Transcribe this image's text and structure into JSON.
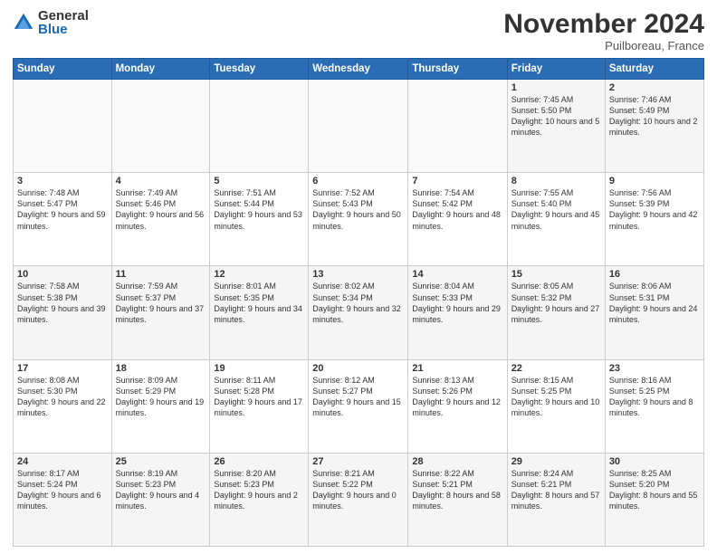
{
  "logo": {
    "general": "General",
    "blue": "Blue"
  },
  "header": {
    "month": "November 2024",
    "location": "Puilboreau, France"
  },
  "days_of_week": [
    "Sunday",
    "Monday",
    "Tuesday",
    "Wednesday",
    "Thursday",
    "Friday",
    "Saturday"
  ],
  "weeks": [
    [
      {
        "day": "",
        "info": ""
      },
      {
        "day": "",
        "info": ""
      },
      {
        "day": "",
        "info": ""
      },
      {
        "day": "",
        "info": ""
      },
      {
        "day": "",
        "info": ""
      },
      {
        "day": "1",
        "info": "Sunrise: 7:45 AM\nSunset: 5:50 PM\nDaylight: 10 hours and 5 minutes."
      },
      {
        "day": "2",
        "info": "Sunrise: 7:46 AM\nSunset: 5:49 PM\nDaylight: 10 hours and 2 minutes."
      }
    ],
    [
      {
        "day": "3",
        "info": "Sunrise: 7:48 AM\nSunset: 5:47 PM\nDaylight: 9 hours and 59 minutes."
      },
      {
        "day": "4",
        "info": "Sunrise: 7:49 AM\nSunset: 5:46 PM\nDaylight: 9 hours and 56 minutes."
      },
      {
        "day": "5",
        "info": "Sunrise: 7:51 AM\nSunset: 5:44 PM\nDaylight: 9 hours and 53 minutes."
      },
      {
        "day": "6",
        "info": "Sunrise: 7:52 AM\nSunset: 5:43 PM\nDaylight: 9 hours and 50 minutes."
      },
      {
        "day": "7",
        "info": "Sunrise: 7:54 AM\nSunset: 5:42 PM\nDaylight: 9 hours and 48 minutes."
      },
      {
        "day": "8",
        "info": "Sunrise: 7:55 AM\nSunset: 5:40 PM\nDaylight: 9 hours and 45 minutes."
      },
      {
        "day": "9",
        "info": "Sunrise: 7:56 AM\nSunset: 5:39 PM\nDaylight: 9 hours and 42 minutes."
      }
    ],
    [
      {
        "day": "10",
        "info": "Sunrise: 7:58 AM\nSunset: 5:38 PM\nDaylight: 9 hours and 39 minutes."
      },
      {
        "day": "11",
        "info": "Sunrise: 7:59 AM\nSunset: 5:37 PM\nDaylight: 9 hours and 37 minutes."
      },
      {
        "day": "12",
        "info": "Sunrise: 8:01 AM\nSunset: 5:35 PM\nDaylight: 9 hours and 34 minutes."
      },
      {
        "day": "13",
        "info": "Sunrise: 8:02 AM\nSunset: 5:34 PM\nDaylight: 9 hours and 32 minutes."
      },
      {
        "day": "14",
        "info": "Sunrise: 8:04 AM\nSunset: 5:33 PM\nDaylight: 9 hours and 29 minutes."
      },
      {
        "day": "15",
        "info": "Sunrise: 8:05 AM\nSunset: 5:32 PM\nDaylight: 9 hours and 27 minutes."
      },
      {
        "day": "16",
        "info": "Sunrise: 8:06 AM\nSunset: 5:31 PM\nDaylight: 9 hours and 24 minutes."
      }
    ],
    [
      {
        "day": "17",
        "info": "Sunrise: 8:08 AM\nSunset: 5:30 PM\nDaylight: 9 hours and 22 minutes."
      },
      {
        "day": "18",
        "info": "Sunrise: 8:09 AM\nSunset: 5:29 PM\nDaylight: 9 hours and 19 minutes."
      },
      {
        "day": "19",
        "info": "Sunrise: 8:11 AM\nSunset: 5:28 PM\nDaylight: 9 hours and 17 minutes."
      },
      {
        "day": "20",
        "info": "Sunrise: 8:12 AM\nSunset: 5:27 PM\nDaylight: 9 hours and 15 minutes."
      },
      {
        "day": "21",
        "info": "Sunrise: 8:13 AM\nSunset: 5:26 PM\nDaylight: 9 hours and 12 minutes."
      },
      {
        "day": "22",
        "info": "Sunrise: 8:15 AM\nSunset: 5:25 PM\nDaylight: 9 hours and 10 minutes."
      },
      {
        "day": "23",
        "info": "Sunrise: 8:16 AM\nSunset: 5:25 PM\nDaylight: 9 hours and 8 minutes."
      }
    ],
    [
      {
        "day": "24",
        "info": "Sunrise: 8:17 AM\nSunset: 5:24 PM\nDaylight: 9 hours and 6 minutes."
      },
      {
        "day": "25",
        "info": "Sunrise: 8:19 AM\nSunset: 5:23 PM\nDaylight: 9 hours and 4 minutes."
      },
      {
        "day": "26",
        "info": "Sunrise: 8:20 AM\nSunset: 5:23 PM\nDaylight: 9 hours and 2 minutes."
      },
      {
        "day": "27",
        "info": "Sunrise: 8:21 AM\nSunset: 5:22 PM\nDaylight: 9 hours and 0 minutes."
      },
      {
        "day": "28",
        "info": "Sunrise: 8:22 AM\nSunset: 5:21 PM\nDaylight: 8 hours and 58 minutes."
      },
      {
        "day": "29",
        "info": "Sunrise: 8:24 AM\nSunset: 5:21 PM\nDaylight: 8 hours and 57 minutes."
      },
      {
        "day": "30",
        "info": "Sunrise: 8:25 AM\nSunset: 5:20 PM\nDaylight: 8 hours and 55 minutes."
      }
    ]
  ]
}
